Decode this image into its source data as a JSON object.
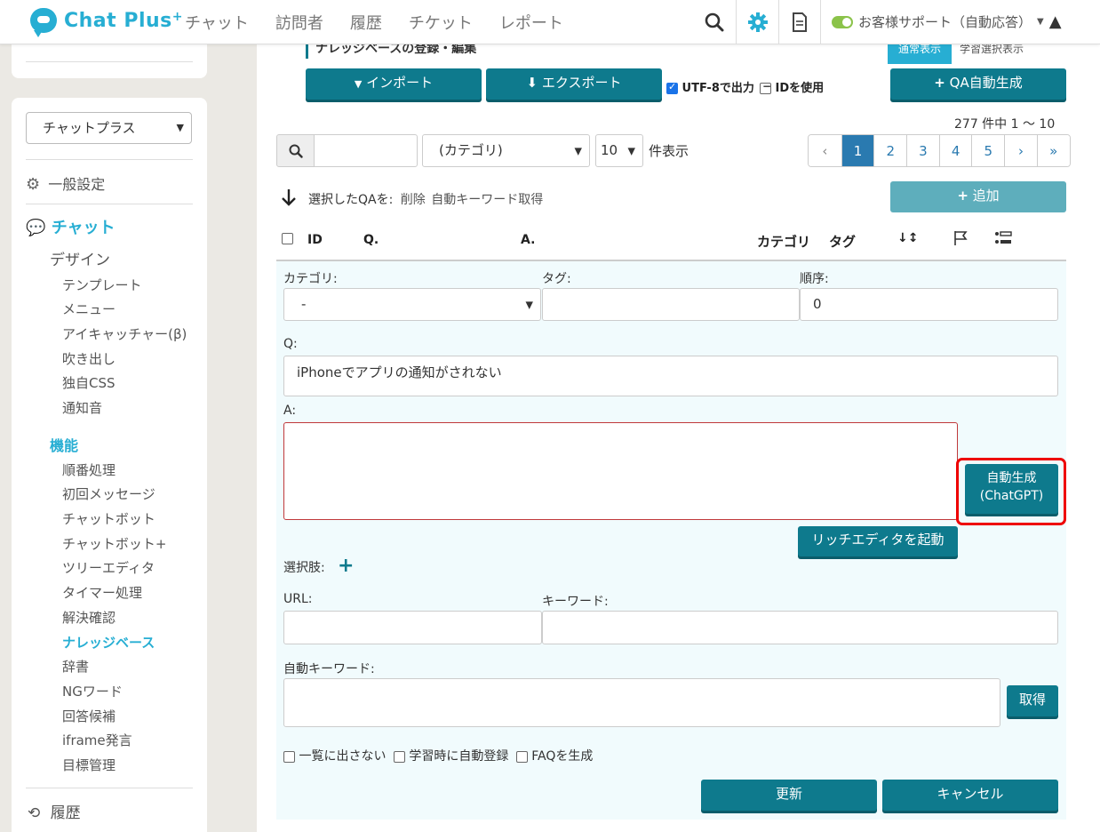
{
  "header": {
    "logo_text": "Chat Plus",
    "logo_sup": "+",
    "nav": [
      "チャット",
      "訪問者",
      "履歴",
      "チケット",
      "レポート"
    ],
    "account_label": "お客様サポート（自動応答）"
  },
  "sidebar": {
    "site_select": "チャットプラス",
    "general_settings": "一般設定",
    "chat_section": "チャット",
    "design": "デザイン",
    "design_items": [
      "テンプレート",
      "メニュー",
      "アイキャッチャー(β)",
      "吹き出し",
      "独自CSS",
      "通知音"
    ],
    "function_heading": "機能",
    "function_items": [
      "順番処理",
      "初回メッセージ",
      "チャットボット",
      "チャットボット+",
      "ツリーエディタ",
      "タイマー処理",
      "解決確認",
      "ナレッジベース",
      "辞書",
      "NGワード",
      "回答候補",
      "iframe発言",
      "目標管理"
    ],
    "history": "履歴"
  },
  "toolbar": {
    "title_partial": "ナレッジベースの登録・編集",
    "tab_normal": "通常表示",
    "tab_learn": "学習選択表示",
    "import_label": "インポート",
    "export_label": "エクスポート",
    "utf8_label": "UTF-8で出力",
    "id_label": "IDを使用",
    "qa_generate_label": "QA自動生成",
    "count_text": "277 件中 1 〜 10",
    "search_placeholder": "",
    "category_filter": "(カテゴリ)",
    "per_page": "10",
    "per_page_suffix": "件表示",
    "pages": [
      "‹",
      "1",
      "2",
      "3",
      "4",
      "5",
      "›",
      "»"
    ],
    "bulk_label": "選択したQAを:",
    "bulk_delete": "削除",
    "bulk_keyword": "自動キーワード取得",
    "add_label": "追加"
  },
  "table": {
    "headers": [
      "ID",
      "Q.",
      "A.",
      "カテゴリ",
      "タグ"
    ]
  },
  "form": {
    "category_label": "カテゴリ:",
    "category_value": "-",
    "tag_label": "タグ:",
    "tag_value": "",
    "order_label": "順序:",
    "order_value": "0",
    "q_label": "Q:",
    "q_value": "iPhoneでアプリの通知がされない",
    "a_label": "A:",
    "a_value": "",
    "auto_gen_line1": "自動生成",
    "auto_gen_line2": "(ChatGPT)",
    "rich_editor_label": "リッチエディタを起動",
    "choices_label": "選択肢:",
    "url_label": "URL:",
    "url_value": "",
    "keyword_label": "キーワード:",
    "keyword_value": "",
    "auto_keyword_label": "自動キーワード:",
    "auto_keyword_value": "",
    "fetch_label": "取得",
    "opt_hide": "一覧に出さない",
    "opt_auto_register": "学習時に自動登録",
    "opt_faq": "FAQを生成",
    "update_label": "更新",
    "cancel_label": "キャンセル"
  },
  "colors": {
    "accent": "#27aed3",
    "button": "#0e7a8d",
    "highlight": "#e00000",
    "page_active": "#2a7ab0"
  }
}
